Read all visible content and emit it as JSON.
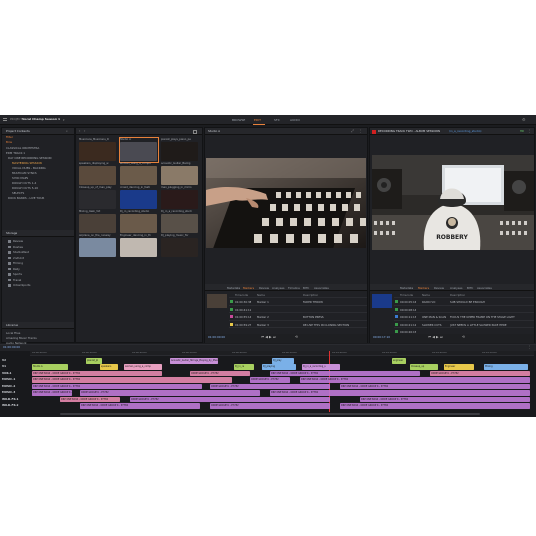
{
  "app": {
    "project_prefix": "PROJECT",
    "project_name": "Vocal Champ Season 1",
    "nav": [
      {
        "label": "BROWSE"
      },
      {
        "label": "EDIT"
      },
      {
        "label": "SFX"
      },
      {
        "label": "AUDIO"
      }
    ],
    "active_nav": "EDIT"
  },
  "browser": {
    "title": "Project Contents",
    "filter_label": "Filter",
    "bins_label": "Bins",
    "tree": [
      {
        "label": "CLASSICAL ORCHESTRA"
      },
      {
        "label": "EDM TRACK 1"
      },
      {
        "label": "DAY ONE RECORDING SESSION"
      },
      {
        "label": "MASTERING SESSION",
        "highlight": true
      },
      {
        "label": "VOCAL DUBS - BACKING"
      },
      {
        "label": "MULTICAM SYNCS"
      },
      {
        "label": "SYNC MAPS"
      },
      {
        "label": "ROUGH CUTS 1-4"
      },
      {
        "label": "ROUGH CUTS 5-16"
      },
      {
        "label": "SELECTS"
      },
      {
        "label": "ROCK BANDS - LIVE TOUR"
      }
    ],
    "storage_title": "Storage",
    "storage": [
      {
        "label": "Review"
      },
      {
        "label": "Rushes"
      },
      {
        "label": "StudioWest"
      },
      {
        "label": "2ndUnit"
      },
      {
        "label": "Filming"
      },
      {
        "label": "Rally"
      },
      {
        "label": "Sports"
      },
      {
        "label": "Travel"
      },
      {
        "label": "UrbanSports"
      }
    ],
    "libraries_title": "Libraries",
    "libraries": [
      {
        "label": "Local Files"
      },
      {
        "label": "Amazing Music Tracks"
      },
      {
        "label": "Audio Network"
      },
      {
        "label": "Pond5"
      }
    ]
  },
  "thumbs": [
    {
      "label": "Musicians_Musicians_R",
      "color": "#3b2a1f"
    },
    {
      "label": "Studio A",
      "color": "#4a4a52"
    },
    {
      "label": "pianist_plays_piano_pe",
      "color": "#1f1b19"
    },
    {
      "label": "speakers_displaying_w",
      "color": "#5a4a3c"
    },
    {
      "label": "woman_using_a_compu",
      "color": "#6b5b4a"
    },
    {
      "label": "acoustic_Guitar_Backg",
      "color": "#8a7a68"
    },
    {
      "label": "Closeup_up_of_man_play",
      "color": "#2a2a2e"
    },
    {
      "label": "crowd_dancing_in_festi",
      "color": "#1a3a8a"
    },
    {
      "label": "man_plugging_in_micro",
      "color": "#2a1a1a"
    },
    {
      "label": "Mixing_desk_Vid",
      "color": "#4a4038"
    },
    {
      "label": "Dj_in_recording_studio",
      "color": "#6a5a4a"
    },
    {
      "label": "Dj_in_a_recording_studi",
      "color": "#585048"
    },
    {
      "label": "airplane_on_the_runway",
      "color": "#7a8aa0"
    },
    {
      "label": "Engineer_dancing_in_th",
      "color": "#c0b8b0"
    },
    {
      "label": "DJ_playing_music_for",
      "color": "#2a2422"
    }
  ],
  "viewer_left": {
    "title": "Studio A",
    "timecode_left": "01:00:00:00",
    "tabs": [
      {
        "label": "Metadata"
      },
      {
        "label": "Markers"
      },
      {
        "label": "Review"
      },
      {
        "label": "Analyses"
      },
      {
        "label": "Timeline"
      },
      {
        "label": "BITC"
      },
      {
        "label": "Associates"
      }
    ],
    "active_tab": "Markers",
    "markers_header": {
      "tc": "Timecode",
      "name": "Name",
      "desc": "Description"
    },
    "markers": [
      {
        "tc": "01:00:30:38",
        "name": "Marker 1",
        "desc": "FADER THROW",
        "color": "#3a9a4a"
      },
      {
        "tc": "01:00:41:11",
        "name": "",
        "desc": "",
        "color": "#3a9a4a"
      },
      {
        "tc": "01:00:55:14",
        "name": "Marker 2",
        "desc": "BUTTON PRESS",
        "color": "#c84a9a"
      },
      {
        "tc": "01:00:59:27",
        "name": "Marker 3",
        "desc": "RE-USE THIS IN CLOSING SECTION",
        "color": "#e8c84a"
      }
    ]
  },
  "viewer_right": {
    "title": "RECORDING TRACK TWO - ALBUM SESSIONS",
    "subtitle": "(in_a_recording_studio)",
    "badge": "HD",
    "hoodie_text": "ROBBERY",
    "timecode_left": "00:00:17:10",
    "tabs": [
      {
        "label": "Metadata"
      },
      {
        "label": "Markers"
      },
      {
        "label": "Review"
      },
      {
        "label": "Analyses"
      },
      {
        "label": "BITC"
      },
      {
        "label": "Associates"
      }
    ],
    "active_tab": "Markers",
    "markers_header": {
      "tc": "Timecode",
      "name": "Name",
      "desc": "Description"
    },
    "markers": [
      {
        "tc": "00:00:05:16",
        "name": "RADIO VO",
        "desc": "SUB SHOULD BE ENOUGH",
        "color": "#3a9a4a"
      },
      {
        "tc": "00:00:08:14",
        "name": "",
        "desc": "",
        "color": "#3a9a4a"
      },
      {
        "tc": "00:00:11:13",
        "name": "ONE MAN & SCAN",
        "desc": "FOCUS THE UPPER FRAME ON THE STAGE LIGHT",
        "color": "#3a7ad0"
      },
      {
        "tc": "00:00:21:12",
        "name": "SLOWER CUTS",
        "desc": "JUST NEEDS A LITTLE SLOWER PACE HERE",
        "color": "#3a9a4a"
      },
      {
        "tc": "00:00:26:15",
        "name": "",
        "desc": "",
        "color": "#3a9a4a"
      }
    ]
  },
  "timeline": {
    "timecode": "01:00:00:00",
    "ruler": [
      "01:00:00:00",
      "01:00:10:00",
      "01:00:20:00",
      "01:00:30:00",
      "01:00:40:00",
      "01:00:50:00",
      "01:01:00:00",
      "01:01:10:00",
      "01:01:20:00",
      "01:01:30:00"
    ],
    "tracks": [
      {
        "label": "V2"
      },
      {
        "label": "V1"
      },
      {
        "label": "VOX-1"
      },
      {
        "label": "MUSIC-1"
      },
      {
        "label": "MUSIC-2"
      },
      {
        "label": "MUSIC-3"
      },
      {
        "label": "WILD-FX-1"
      },
      {
        "label": "WILD-FX-2"
      }
    ],
    "clips_v2": [
      {
        "label": "pianist_pl",
        "color": "#a8d060"
      },
      {
        "label": "Acoustic_Guitar_Strings_Playing_by_Musician",
        "color": "#c890d8"
      },
      {
        "label": "DJ_play",
        "color": "#7ab0e8"
      },
      {
        "label": "engineer",
        "color": "#a8d060"
      }
    ],
    "clips_v1": [
      {
        "label": "Studio A",
        "color": "#a8d060"
      },
      {
        "label": "speakers",
        "color": "#e8c84a"
      },
      {
        "label": "woman_using_a_comp",
        "color": "#e8a0c0"
      },
      {
        "label": "Dj_in_re",
        "color": "#a8d060"
      },
      {
        "label": "DJ_playing",
        "color": "#7ab0e8"
      },
      {
        "label": "Dj_in_a_recording_s",
        "color": "#c890d8"
      },
      {
        "label": "Closeup_up",
        "color": "#a8d060"
      },
      {
        "label": "Engineer",
        "color": "#e8c84a"
      },
      {
        "label": "Mixing",
        "color": "#7ab0e8"
      }
    ],
    "audio_clip_label": "DRP ONE BASS - ODDE GROUP K - P7782",
    "audio_clip_label_short": "ODDE GROUP K - P7782"
  }
}
